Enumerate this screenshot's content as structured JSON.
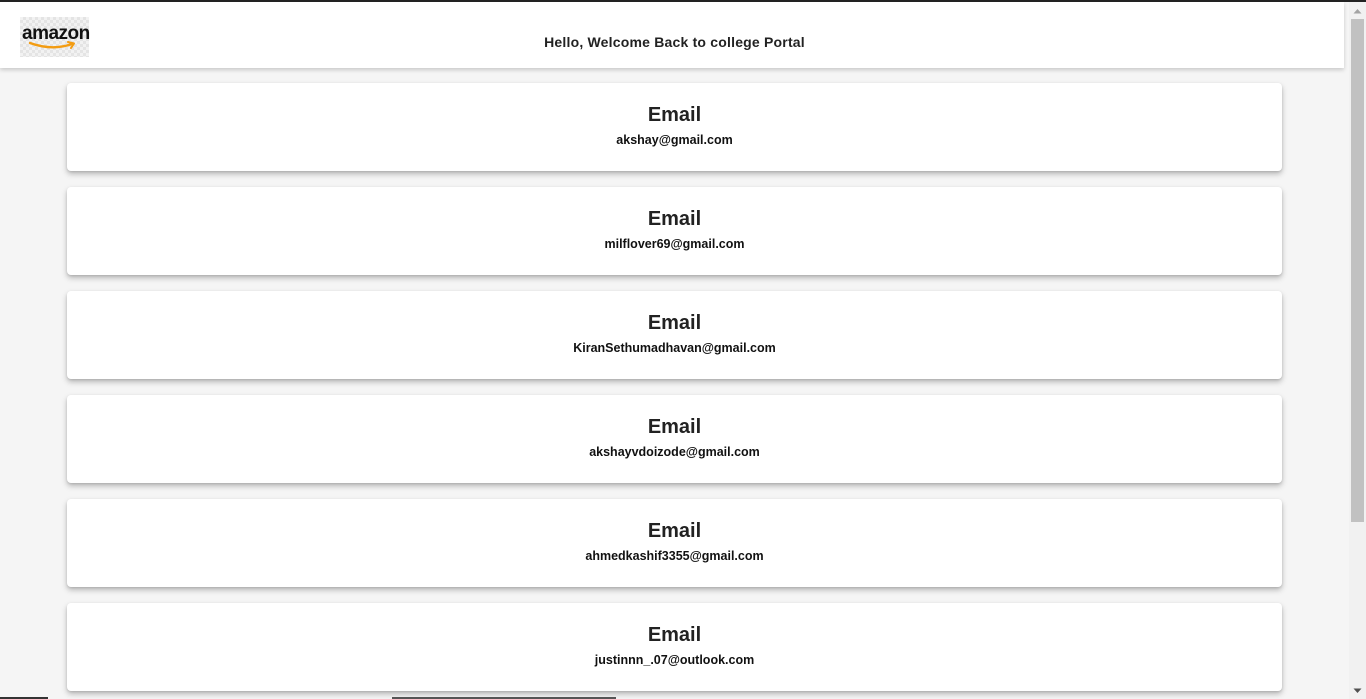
{
  "header": {
    "logo_text": "amazon",
    "welcome_text": "Hello, Welcome Back to college Portal"
  },
  "cards": [
    {
      "title": "Email",
      "value": "akshay@gmail.com"
    },
    {
      "title": "Email",
      "value": "milflover69@gmail.com"
    },
    {
      "title": "Email",
      "value": "KiranSethumadhavan@gmail.com"
    },
    {
      "title": "Email",
      "value": "akshayvdoizode@gmail.com"
    },
    {
      "title": "Email",
      "value": "ahmedkashif3355@gmail.com"
    },
    {
      "title": "Email",
      "value": "justinnn_.07@outlook.com"
    }
  ],
  "colors": {
    "background": "#f5f5f5",
    "card": "#ffffff",
    "text": "#222222",
    "logo_smile": "#f39c12"
  },
  "icons": {
    "scroll_up": "chevron-up-icon",
    "scroll_down": "chevron-down-icon"
  }
}
